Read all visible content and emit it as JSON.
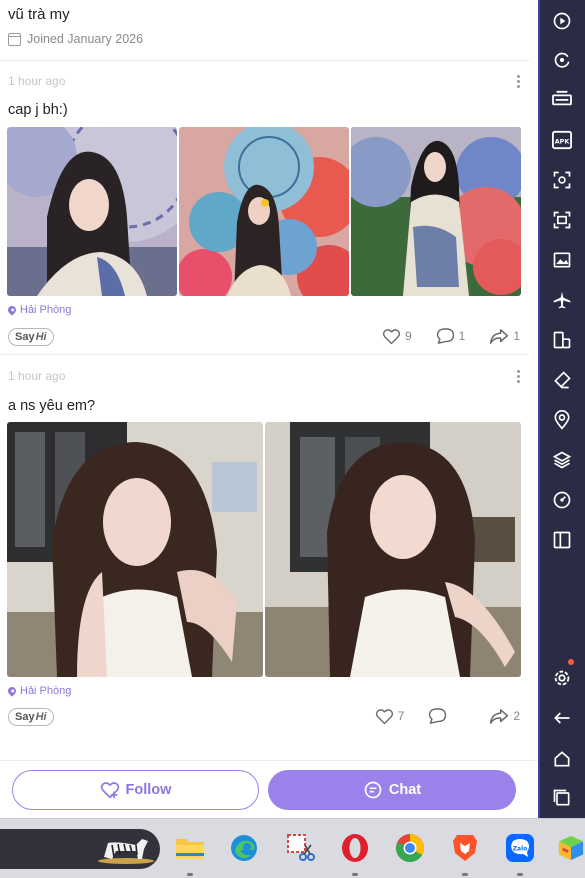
{
  "profile": {
    "name": "vũ trà my",
    "joined": "Joined January 2026"
  },
  "posts": [
    {
      "time": "1 hour ago",
      "caption": "cap j bh:)",
      "location": "Hải Phòng",
      "likes": "9",
      "comments": "1",
      "shares": "1"
    },
    {
      "time": "1 hour ago",
      "caption": "a ns yêu em?",
      "location": "Hải Phòng",
      "likes": "7",
      "comments": "",
      "shares": "2"
    }
  ],
  "sayhi": {
    "say": "Say",
    "hi": "Hi"
  },
  "buttons": {
    "follow": "Follow",
    "chat": "Chat"
  },
  "colors": {
    "accent": "#9b82ea",
    "sidebar": "#2a2b44"
  },
  "sidebar_tools": [
    "play-icon",
    "rotate-icon",
    "keyboard-icon",
    "apk-icon",
    "screenshot-icon",
    "record-icon",
    "media-icon",
    "airplane-icon",
    "multi-instance-icon",
    "eraser-icon",
    "location-icon",
    "layers-icon",
    "speed-icon",
    "sidebar-toggle-icon",
    "settings-icon",
    "back-icon",
    "home-icon",
    "recents-icon"
  ],
  "taskbar_apps": [
    "file-explorer-icon",
    "edge-icon",
    "snipping-tool-icon",
    "opera-icon",
    "chrome-icon",
    "brave-icon",
    "zalo-icon",
    "bluestacks-icon"
  ],
  "zalo_label": "Zalo"
}
